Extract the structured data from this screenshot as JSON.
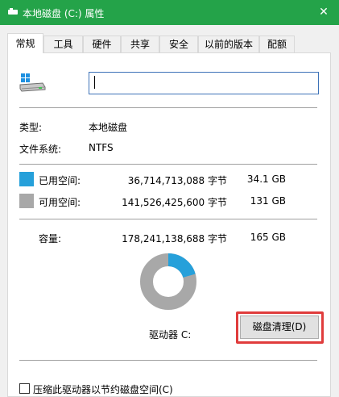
{
  "window": {
    "title": "本地磁盘 (C:) 属性",
    "close_glyph": "✕"
  },
  "tabs": [
    {
      "label": "常规",
      "active": true
    },
    {
      "label": "工具",
      "active": false
    },
    {
      "label": "硬件",
      "active": false
    },
    {
      "label": "共享",
      "active": false
    },
    {
      "label": "安全",
      "active": false
    },
    {
      "label": "以前的版本",
      "active": false
    },
    {
      "label": "配额",
      "active": false
    }
  ],
  "general": {
    "name_value": "",
    "type_label": "类型:",
    "type_value": "本地磁盘",
    "fs_label": "文件系统:",
    "fs_value": "NTFS"
  },
  "space": {
    "used": {
      "label": "已用空间:",
      "bytes": "36,714,713,088 字节",
      "size": "34.1 GB",
      "color": "#26a0da"
    },
    "free": {
      "label": "可用空间:",
      "bytes": "141,526,425,600 字节",
      "size": "131 GB",
      "color": "#a8a8a8"
    },
    "capacity": {
      "label": "容量:",
      "bytes": "178,241,138,688 字节",
      "size": "165 GB"
    }
  },
  "usage": {
    "used_fraction": 0.206
  },
  "drive": {
    "label": "驱动器 C:"
  },
  "cleanup_button": {
    "label": "磁盘清理(D)"
  },
  "compress_option": {
    "label": "压缩此驱动器以节约磁盘空间(C)",
    "checked": false
  },
  "colors": {
    "titlebar": "#24a349",
    "highlight": "#e03c3c",
    "input_border": "#3d72b8"
  }
}
